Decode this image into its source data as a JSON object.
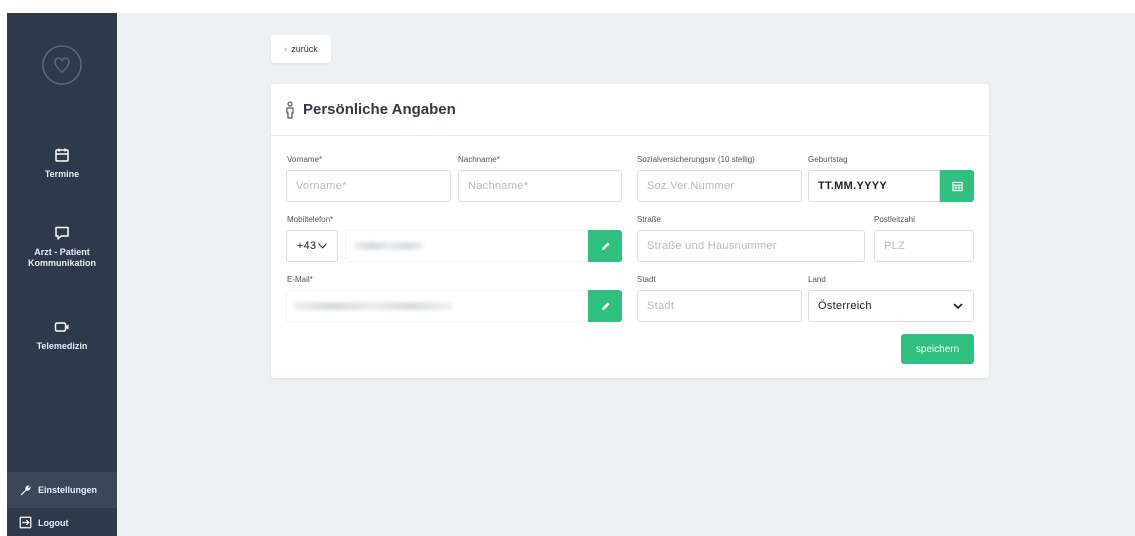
{
  "sidebar": {
    "items": [
      {
        "label": "Termine",
        "icon": "calendar-icon"
      },
      {
        "label": "Arzt - Patient Kommunikation",
        "icon": "chat-icon"
      },
      {
        "label": "Telemedizin",
        "icon": "video-icon"
      }
    ],
    "settings_label": "Einstellungen",
    "logout_label": "Logout"
  },
  "back_label": "zurück",
  "card": {
    "title": "Persönliche Angaben",
    "fields": {
      "vorname": {
        "label": "Vorname*",
        "placeholder": "Vorname*"
      },
      "nachname": {
        "label": "Nachname*",
        "placeholder": "Nachname*"
      },
      "svnr": {
        "label": "Sozialversicherungsnr (10 stellig)",
        "placeholder": "Soz.Ver.Nummer"
      },
      "geburtstag": {
        "label": "Geburtstag",
        "value": "TT.MM.YYYY"
      },
      "mobil": {
        "label": "Mobiltelefon*",
        "prefix": "+43"
      },
      "strasse": {
        "label": "Straße",
        "placeholder": "Straße und Hausnummer"
      },
      "plz": {
        "label": "Postleitzahl",
        "placeholder": "PLZ"
      },
      "email": {
        "label": "E-Mail*"
      },
      "stadt": {
        "label": "Stadt",
        "placeholder": "Stadt"
      },
      "land": {
        "label": "Land",
        "value": "Österreich"
      }
    },
    "save_label": "speichern"
  },
  "colors": {
    "sidebar": "#2d3a4b",
    "accent": "#2fbf7f",
    "background": "#eef1f4"
  }
}
